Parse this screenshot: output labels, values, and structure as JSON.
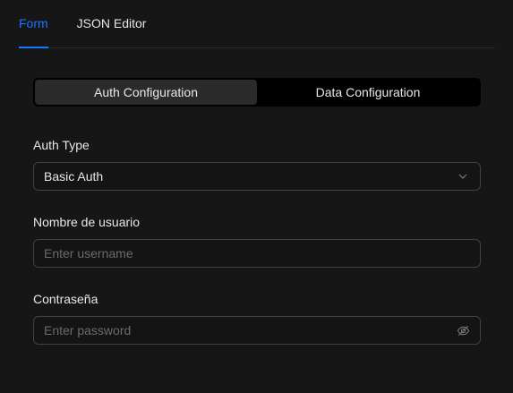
{
  "tabs": {
    "form": "Form",
    "json_editor": "JSON Editor",
    "active": "form"
  },
  "segments": {
    "auth": "Auth Configuration",
    "data": "Data Configuration",
    "active": "auth"
  },
  "form": {
    "auth_type": {
      "label": "Auth Type",
      "value": "Basic Auth"
    },
    "username": {
      "label": "Nombre de usuario",
      "placeholder": "Enter username",
      "value": ""
    },
    "password": {
      "label": "Contraseña",
      "placeholder": "Enter password",
      "value": ""
    }
  },
  "colors": {
    "accent": "#1677ff",
    "background": "#161616",
    "border": "#424242"
  },
  "icons": {
    "select_arrow": "chevron-down-icon",
    "password_toggle": "eye-off-icon"
  }
}
